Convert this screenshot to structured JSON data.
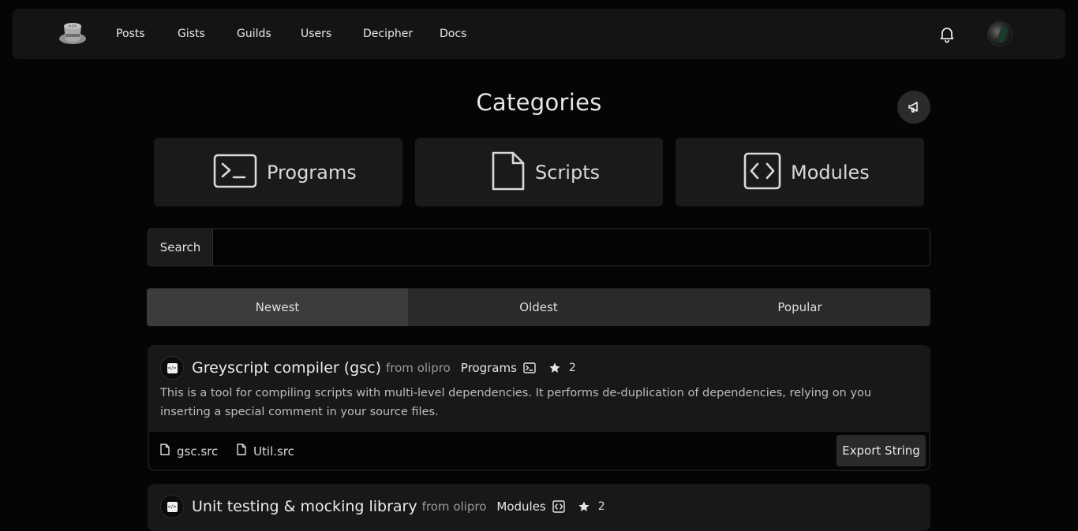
{
  "nav": {
    "links": [
      "Posts",
      "Gists",
      "Guilds",
      "Users",
      "Decipher",
      "Docs"
    ]
  },
  "header": {
    "title": "Categories"
  },
  "categories": [
    {
      "label": "Programs",
      "icon": "terminal-icon"
    },
    {
      "label": "Scripts",
      "icon": "file-icon"
    },
    {
      "label": "Modules",
      "icon": "code-icon"
    }
  ],
  "search": {
    "label": "Search",
    "value": "",
    "placeholder": ""
  },
  "sort": {
    "tabs": [
      "Newest",
      "Oldest",
      "Popular"
    ],
    "active": "Newest"
  },
  "posts": [
    {
      "title": "Greyscript compiler (gsc)",
      "from": "from",
      "author": "olipro",
      "category": "Programs",
      "stars": "2",
      "description": "This is a tool for compiling scripts with multi-level dependencies. It performs de-duplication of dependencies, relying on you inserting a special comment in your source files.",
      "files": [
        "gsc.src",
        "Util.src"
      ],
      "export_label": "Export String"
    },
    {
      "title": "Unit testing & mocking library",
      "from": "from",
      "author": "olipro",
      "category": "Modules",
      "stars": "2"
    }
  ],
  "colors": {
    "background": "#050505",
    "navbar": "#141414",
    "card": "#181818",
    "active_tab": "#3c3c3c"
  }
}
